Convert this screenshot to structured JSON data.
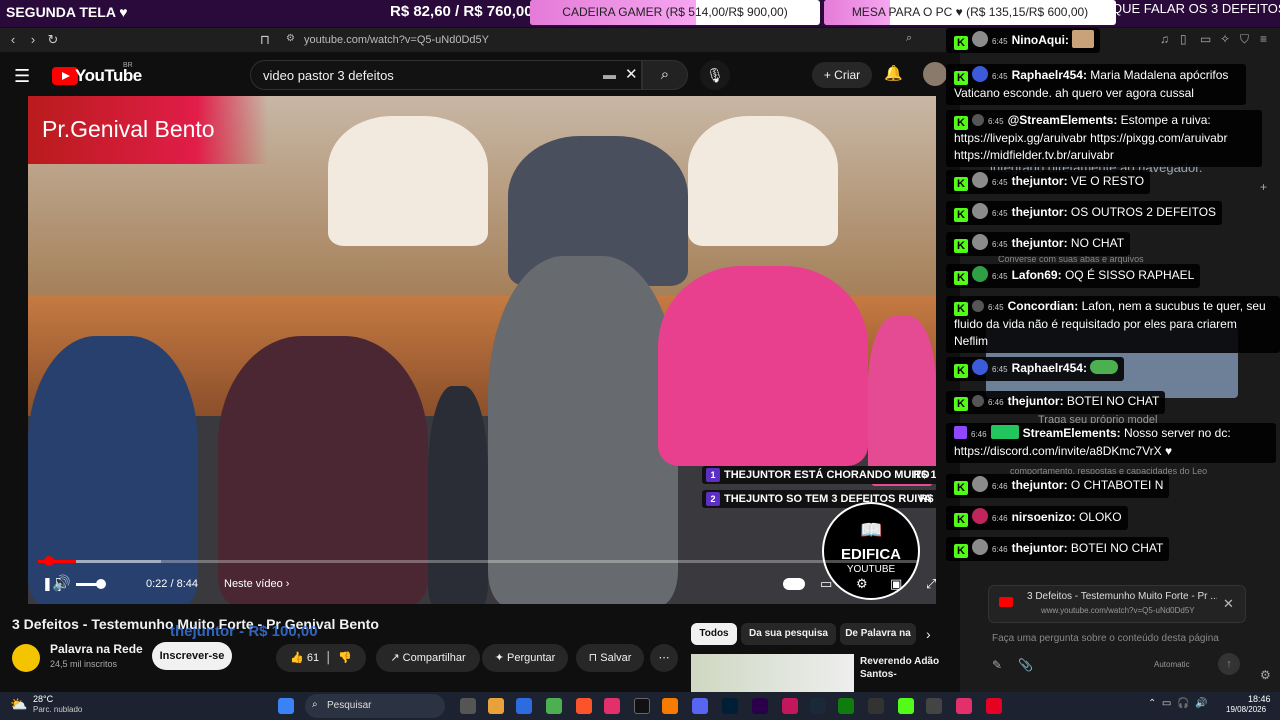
{
  "stream_bar": {
    "left_label": "SEGUNDA TELA ♥",
    "price": "R$ 82,60 / R$ 760,00",
    "goals": [
      {
        "label": "CADEIRA GAMER (R$ 514,00/R$ 900,00)",
        "progress": 0.571
      },
      {
        "label": "MESA PARA O PC ♥ (R$ 135,15/R$ 600,00)",
        "progress": 0.225
      }
    ],
    "ticker": "QUE FALAR OS 3 DEFEITOS"
  },
  "browser": {
    "url": "youtube.com/watch?v=Q5-uNd0Dd5Y"
  },
  "youtube": {
    "logo": "YouTube",
    "country": "BR",
    "search_value": "video pastor 3 defeitos",
    "create_label": "Criar"
  },
  "video": {
    "overlay_title": "Pr.Genival Bento",
    "time": "0:22 / 8:44",
    "next_label": "Neste vídeo",
    "progress": 0.042,
    "volume": 0.6,
    "watermark_line1": "EDIFICA",
    "watermark_line2": "YOUTUBE",
    "donations": [
      {
        "num": "1",
        "text": "THEJUNTOR ESTÁ CHORANDO MUITO",
        "amount": "R$ 14,60"
      },
      {
        "num": "2",
        "text": "THEJUNTO SO TEM 3 DEFEITOS RUIVA",
        "amount": "R$ 5,00"
      }
    ]
  },
  "video_info": {
    "title": "3 Defeitos - Testemunho Muito Forte - Pr Genival Bento",
    "donor_overlay": "thejuntor - R$ 100,00",
    "channel_name": "Palavra na Rede",
    "channel_subs": "24,5 mil inscritos",
    "subscribe_label": "Inscrever-se",
    "likes": "61",
    "share_label": "Compartilhar",
    "ask_label": "Perguntar",
    "save_label": "Salvar"
  },
  "recommendations": {
    "chips": [
      "Todos",
      "Da sua pesquisa",
      "De Palavra na Rede"
    ],
    "first_title": "Reverendo Adão Santos-"
  },
  "side_panel": {
    "bg_text": "integrado diretamente ao navegador.",
    "note1": "Converse com suas abas e arquivos",
    "note2": "Traga seu próprio model",
    "note3": "comportamento, respostas e capacidades do Leo",
    "ref_title": "3 Defeitos - Testemunho Muito Forte - Pr ...",
    "ref_url": "www.youtube.com/watch?v=Q5-uNd0Dd5Y",
    "ask_placeholder": "Faça uma pergunta sobre o conteúdo desta página",
    "model": "Automatic"
  },
  "chat": [
    {
      "time": "6:45",
      "user": "NinoAqui:",
      "text": "",
      "avatar": "grey",
      "emote": true
    },
    {
      "time": "6:45",
      "user": "Raphaelr454:",
      "text": "Maria Madalena apócrifos Vaticano esconde. ah quero ver agora cussal",
      "avatar": "blue"
    },
    {
      "time": "6:45",
      "user": "@StreamElements:",
      "text": "Estompe a ruiva: https://livepix.gg/aruivabr https://pixgg.com/aruivabr https://midfielder.tv.br/aruivabr",
      "avatar": "badge"
    },
    {
      "time": "6:45",
      "user": "thejuntor:",
      "text": "VE O RESTO",
      "avatar": "grey"
    },
    {
      "time": "6:45",
      "user": "thejuntor:",
      "text": "OS OUTROS 2 DEFEITOS",
      "avatar": "grey"
    },
    {
      "time": "6:45",
      "user": "thejuntor:",
      "text": "NO CHAT",
      "avatar": "grey"
    },
    {
      "time": "6:45",
      "user": "Lafon69:",
      "text": "OQ É SISSO RAPHAEL",
      "avatar": "green"
    },
    {
      "time": "6:45",
      "user": "Concordian:",
      "text": "Lafon, nem a sucubus te quer, seu fluido da vida não é requisitado por eles para criarem Neflim",
      "avatar": "badge"
    },
    {
      "time": "6:45",
      "user": "Raphaelr454:",
      "text": "",
      "avatar": "blue",
      "pepe": true
    },
    {
      "time": "6:46",
      "user": "thejuntor:",
      "text": "BOTEI NO CHAT",
      "avatar": "badge"
    },
    {
      "time": "6:46",
      "user": "StreamElements:",
      "text": "Nosso server no dc: https://discord.com/invite/a8DKmc7VrX ♥",
      "avatar": "twitch"
    },
    {
      "time": "6:46",
      "user": "thejuntor:",
      "text": "O CHTABOTEI N",
      "avatar": "grey"
    },
    {
      "time": "6:46",
      "user": "nirsoenizo:",
      "text": "OLOKO",
      "avatar": "pink"
    },
    {
      "time": "6:46",
      "user": "thejuntor:",
      "text": "BOTEI NO CHAT",
      "avatar": "grey"
    }
  ],
  "taskbar": {
    "temp": "28°C",
    "weather": "Parc. nublado",
    "search": "Pesquisar",
    "time": "18:46",
    "date": "19/08/2026"
  }
}
